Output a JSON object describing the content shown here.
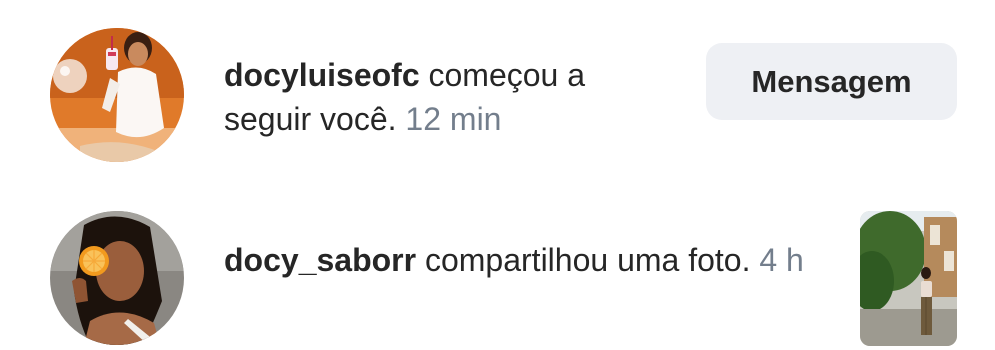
{
  "notifications": [
    {
      "avatar_icon": "profile-photo-woman-orange-background",
      "username": "docyluiseofc",
      "action": "começou a seguir você.",
      "time": "12 min",
      "button_label": "Mensagem"
    },
    {
      "avatar_icon": "profile-photo-woman-holding-orange",
      "username": "docy_saborr",
      "action": "compartilhou uma foto.",
      "time": "4 h",
      "thumbnail_icon": "post-photo-woman-standing-outdoors"
    }
  ],
  "colors": {
    "text": "#262626",
    "muted_time": "#737e8c",
    "button_bg": "#eef0f4",
    "background": "#ffffff"
  }
}
